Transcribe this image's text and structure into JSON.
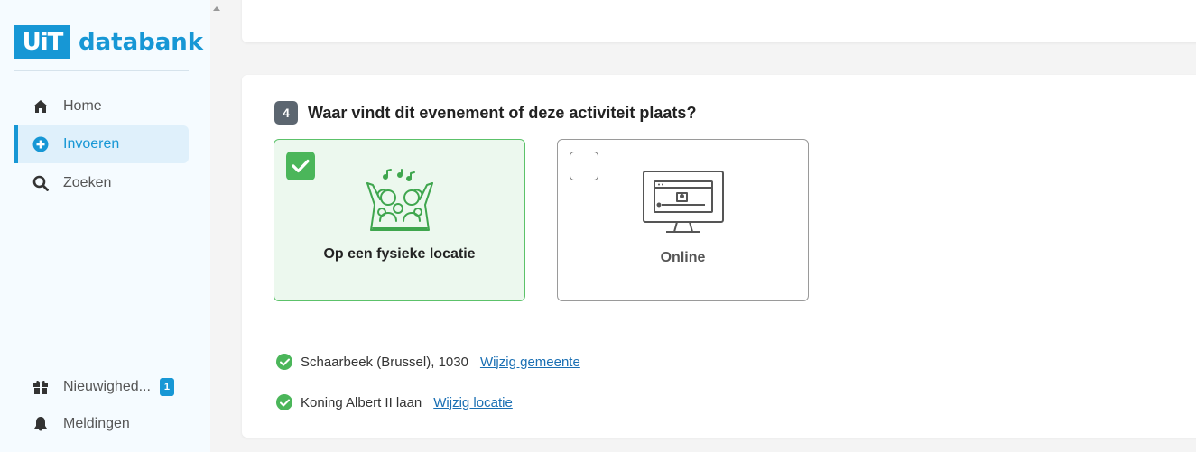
{
  "brand": {
    "badge": "UiT",
    "name": "databank",
    "color": "#1797d5"
  },
  "sidebar": {
    "items": [
      {
        "label": "Home",
        "icon": "home-icon",
        "active": false
      },
      {
        "label": "Invoeren",
        "icon": "plus-circle-icon",
        "active": true
      },
      {
        "label": "Zoeken",
        "icon": "search-icon",
        "active": false
      }
    ],
    "bottom_items": [
      {
        "label": "Nieuwighed...",
        "icon": "gift-icon",
        "badge": "1"
      },
      {
        "label": "Meldingen",
        "icon": "bell-icon"
      }
    ]
  },
  "step": {
    "number": "4",
    "question": "Waar vindt dit evenement of deze activiteit plaats?",
    "options": [
      {
        "label": "Op een fysieke locatie",
        "icon": "crowd-icon",
        "selected": true
      },
      {
        "label": "Online",
        "icon": "monitor-icon",
        "selected": false
      }
    ]
  },
  "location": {
    "municipality": "Schaarbeek (Brussel), 1030",
    "change_municipality": "Wijzig gemeente",
    "place": "Koning Albert II laan",
    "change_place": "Wijzig locatie"
  },
  "colors": {
    "success": "#4bb65a",
    "link": "#1a6fb3",
    "step_badge": "#5c6670"
  }
}
